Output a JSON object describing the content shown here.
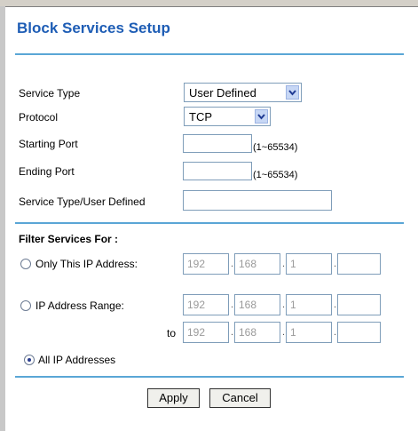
{
  "page": {
    "title": "Block Services Setup"
  },
  "form": {
    "service_type": {
      "label": "Service Type",
      "value": "User Defined"
    },
    "protocol": {
      "label": "Protocol",
      "value": "TCP"
    },
    "starting_port": {
      "label": "Starting Port",
      "value": "",
      "hint": "(1~65534)"
    },
    "ending_port": {
      "label": "Ending Port",
      "value": "",
      "hint": "(1~65534)"
    },
    "service_type_user_defined": {
      "label": "Service Type/User Defined",
      "value": ""
    }
  },
  "filter": {
    "heading": "Filter Services For :",
    "dot": ".",
    "only_this_ip": {
      "label": "Only This IP Address:",
      "checked": false,
      "octets": [
        "192",
        "168",
        "1",
        ""
      ]
    },
    "ip_range": {
      "label": "IP Address Range:",
      "checked": false,
      "start_octets": [
        "192",
        "168",
        "1",
        ""
      ],
      "to_label": "to",
      "end_octets": [
        "192",
        "168",
        "1",
        ""
      ]
    },
    "all_ip": {
      "label": "All IP Addresses",
      "checked": true
    }
  },
  "buttons": {
    "apply": "Apply",
    "cancel": "Cancel"
  },
  "colors": {
    "title": "#1e5db5",
    "rule": "#5aa6d6"
  }
}
